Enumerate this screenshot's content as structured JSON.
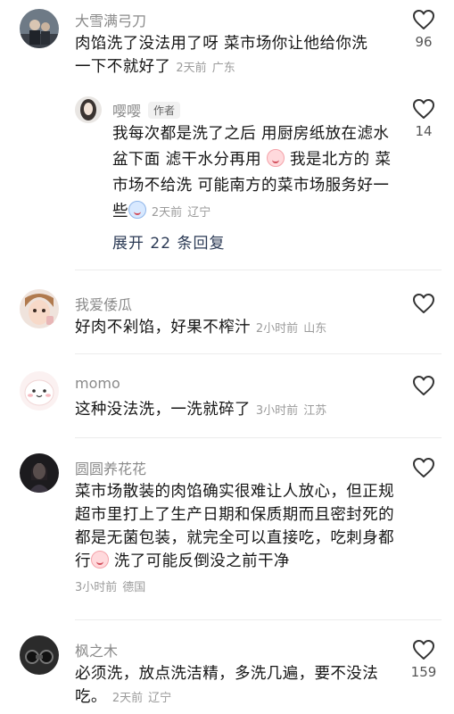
{
  "comments": [
    {
      "username": "大雪满弓刀",
      "text": "肉馅洗了没法用了呀 菜市场你让他给你洗一下不就好了",
      "time": "2天前",
      "location": "广东",
      "likes": "96",
      "reply": {
        "username": "嘤嘤",
        "badge": "作者",
        "text_part1": "我每次都是洗了之后 用厨房纸放在滤水盆下面 滤干水分再用",
        "text_part2": "我是北方的 菜市场不给洗 可能南方的菜市场服务好一些",
        "time": "2天前",
        "location": "辽宁",
        "likes": "14"
      },
      "expand_label": "展开 22 条回复"
    },
    {
      "username": "我爱倭瓜",
      "text": "好肉不剁馅，好果不榨汁",
      "time": "2小时前",
      "location": "山东"
    },
    {
      "username": "momo",
      "text": "这种没法洗，一洗就碎了",
      "time": "3小时前",
      "location": "江苏"
    },
    {
      "username": "圆圆养花花",
      "text_part1": "菜市场散装的肉馅确实很难让人放心，但正规超市里打上了生产日期和保质期而且密封死的都是无菌包装，就完全可以直接吃，吃刺身都行",
      "text_part2": "洗了可能反倒没之前干净",
      "time": "3小时前",
      "location": "德国"
    },
    {
      "username": "枫之木",
      "text": "必须洗，放点洗洁精，多洗几遍，要不没法吃。",
      "time": "2天前",
      "location": "辽宁",
      "likes": "159"
    }
  ]
}
